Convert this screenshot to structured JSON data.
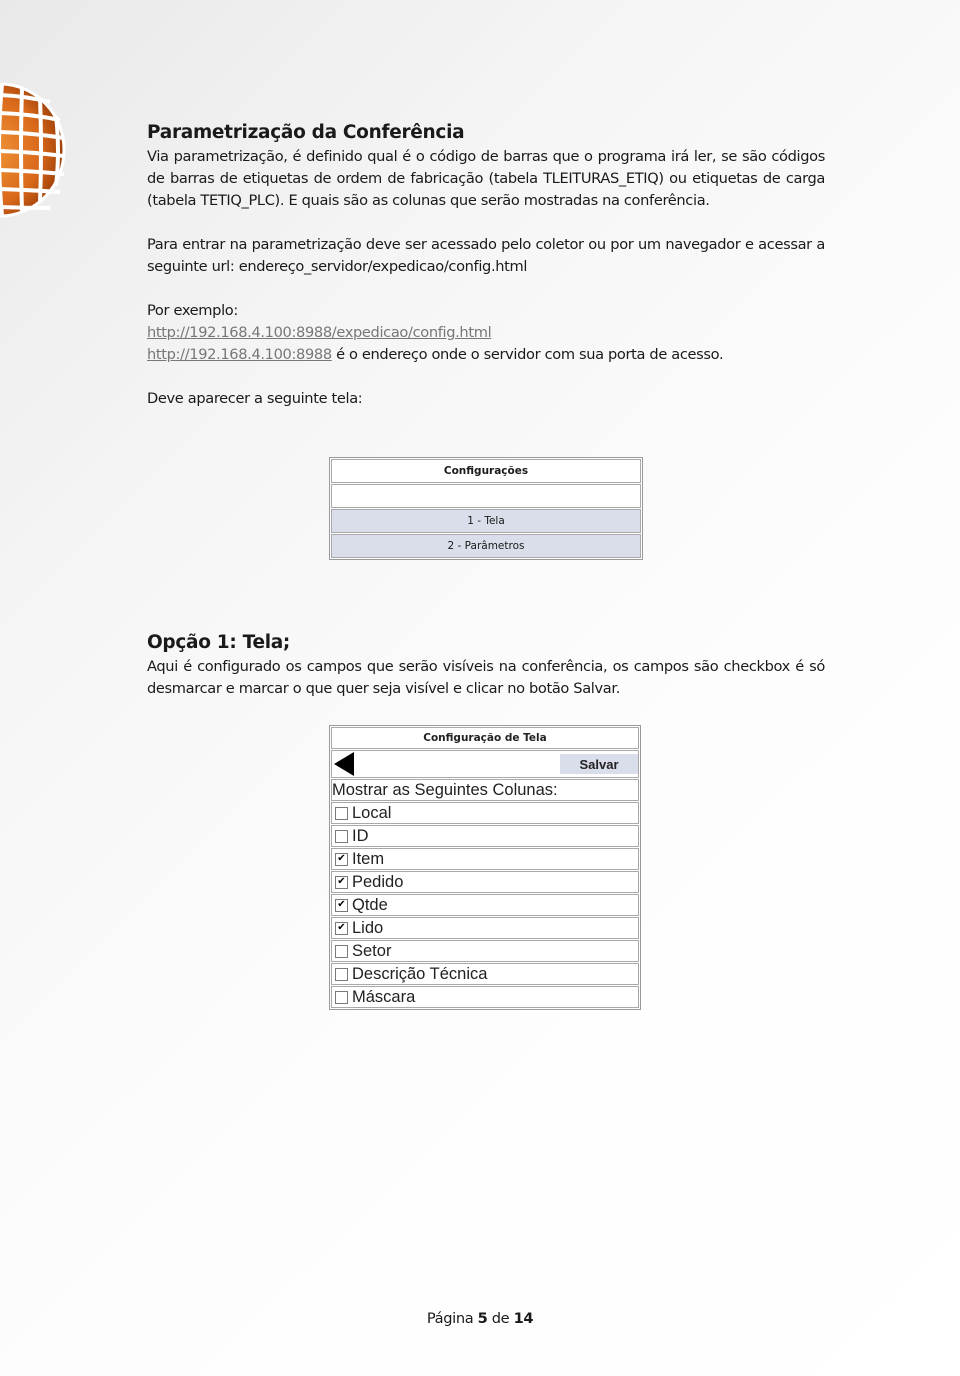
{
  "logo": {
    "icon": "orange-globe-logo"
  },
  "section1": {
    "title": "Parametrização da Conferência",
    "paragraph1": "Via parametrização, é definido qual é o código de barras que o programa irá ler, se são códigos de barras de etiquetas de ordem de fabricação (tabela TLEITURAS_ETIQ) ou etiquetas de carga (tabela TETIQ_PLC). E quais são as colunas que serão mostradas na conferência.",
    "paragraph2": "Para entrar na parametrização deve ser acessado pelo coletor ou por um navegador e acessar a seguinte url: endereço_servidor/expedicao/config.html",
    "example_label": "Por exemplo:",
    "example_link1": "http://192.168.4.100:8988/expedicao/config.html",
    "example_link2": "http://192.168.4.100:8988",
    "example_link2_suffix": " é o endereço onde o servidor com sua porta de acesso.",
    "screen_intro": "Deve aparecer a seguinte tela:"
  },
  "config_menu": {
    "title": "Configurações",
    "options": [
      "1 - Tela",
      "2 - Parâmetros"
    ]
  },
  "section2": {
    "title": "Opção 1: Tela;",
    "paragraph": "Aqui é configurado os campos que serão visíveis na conferência, os campos são checkbox é só desmarcar e marcar o que quer seja visível e clicar no botão Salvar."
  },
  "screen_config": {
    "title": "Configuração de Tela",
    "save_label": "Salvar",
    "columns_label": "Mostrar as Seguintes Colunas:",
    "columns": [
      {
        "label": "Local",
        "checked": false
      },
      {
        "label": "ID",
        "checked": false
      },
      {
        "label": "Item",
        "checked": true
      },
      {
        "label": "Pedido",
        "checked": true
      },
      {
        "label": "Qtde",
        "checked": true
      },
      {
        "label": "Lido",
        "checked": true
      },
      {
        "label": "Setor",
        "checked": false
      },
      {
        "label": "Descrição Técnica",
        "checked": false
      },
      {
        "label": "Máscara",
        "checked": false
      }
    ]
  },
  "footer": {
    "page_prefix": "Página ",
    "page_number": "5",
    "page_middle": " de ",
    "page_total": "14"
  }
}
